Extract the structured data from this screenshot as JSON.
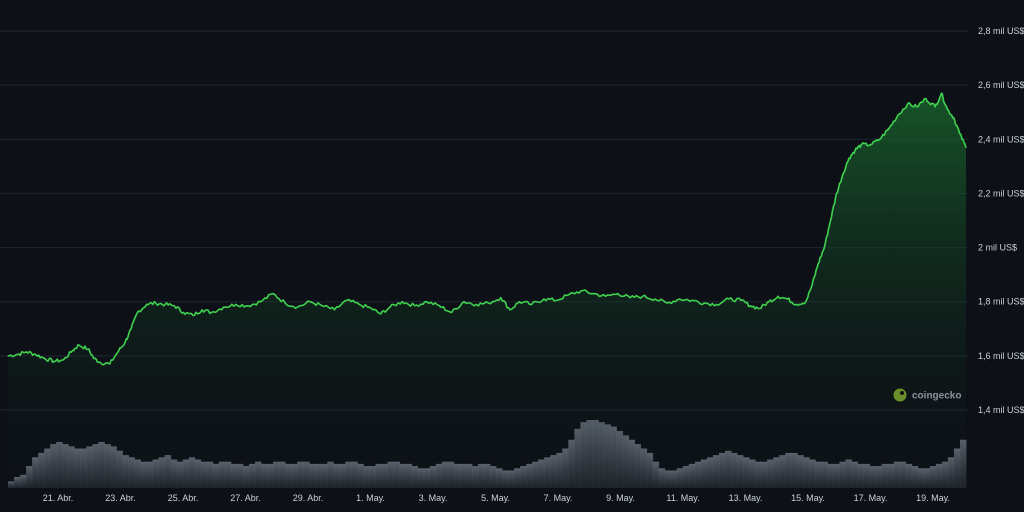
{
  "chart_data": {
    "type": "area",
    "title": "",
    "xlabel": "",
    "ylabel": "",
    "x_ticks": [
      "21. Abr.",
      "23. Abr.",
      "25. Abr.",
      "27. Abr.",
      "29. Abr.",
      "1. May.",
      "3. May.",
      "5. May.",
      "7. May.",
      "9. May.",
      "11. May.",
      "13. May.",
      "15. May.",
      "17. May.",
      "19. May."
    ],
    "y_ticks": [
      {
        "value": 1400,
        "label": "1,4 mil US$"
      },
      {
        "value": 1600,
        "label": "1,6 mil US$"
      },
      {
        "value": 1800,
        "label": "1,8 mil US$"
      },
      {
        "value": 2000,
        "label": "2 mil US$"
      },
      {
        "value": 2200,
        "label": "2,2 mil US$"
      },
      {
        "value": 2400,
        "label": "2,4 mil US$"
      },
      {
        "value": 2600,
        "label": "2,6 mil US$"
      },
      {
        "value": 2800,
        "label": "2,8 mil US$"
      }
    ],
    "ylim": [
      1400,
      2800
    ],
    "xlim": [
      0,
      31.1
    ],
    "x_unit": "days since 20. Abr.",
    "series": [
      {
        "values": [
          [
            0.0,
            1600
          ],
          [
            0.3,
            1605
          ],
          [
            0.6,
            1615
          ],
          [
            0.9,
            1605
          ],
          [
            1.2,
            1590
          ],
          [
            1.5,
            1580
          ],
          [
            1.8,
            1585
          ],
          [
            2.1,
            1620
          ],
          [
            2.3,
            1640
          ],
          [
            2.6,
            1625
          ],
          [
            2.8,
            1590
          ],
          [
            3.0,
            1575
          ],
          [
            3.3,
            1570
          ],
          [
            3.6,
            1620
          ],
          [
            3.8,
            1650
          ],
          [
            4.0,
            1700
          ],
          [
            4.2,
            1760
          ],
          [
            4.5,
            1790
          ],
          [
            4.8,
            1795
          ],
          [
            5.1,
            1790
          ],
          [
            5.4,
            1785
          ],
          [
            5.7,
            1760
          ],
          [
            6.0,
            1750
          ],
          [
            6.3,
            1770
          ],
          [
            6.6,
            1760
          ],
          [
            7.0,
            1780
          ],
          [
            7.4,
            1790
          ],
          [
            7.8,
            1785
          ],
          [
            8.2,
            1800
          ],
          [
            8.6,
            1830
          ],
          [
            9.0,
            1795
          ],
          [
            9.4,
            1780
          ],
          [
            9.8,
            1800
          ],
          [
            10.2,
            1785
          ],
          [
            10.6,
            1770
          ],
          [
            11.0,
            1805
          ],
          [
            11.4,
            1790
          ],
          [
            11.8,
            1775
          ],
          [
            12.1,
            1755
          ],
          [
            12.4,
            1780
          ],
          [
            12.8,
            1800
          ],
          [
            13.2,
            1785
          ],
          [
            13.6,
            1800
          ],
          [
            14.0,
            1785
          ],
          [
            14.4,
            1760
          ],
          [
            14.8,
            1800
          ],
          [
            15.2,
            1790
          ],
          [
            15.6,
            1795
          ],
          [
            16.0,
            1815
          ],
          [
            16.3,
            1770
          ],
          [
            16.6,
            1800
          ],
          [
            17.0,
            1790
          ],
          [
            17.4,
            1810
          ],
          [
            17.8,
            1805
          ],
          [
            18.2,
            1825
          ],
          [
            18.6,
            1840
          ],
          [
            19.0,
            1830
          ],
          [
            19.4,
            1820
          ],
          [
            19.8,
            1830
          ],
          [
            20.2,
            1815
          ],
          [
            20.6,
            1820
          ],
          [
            21.0,
            1810
          ],
          [
            21.4,
            1795
          ],
          [
            21.8,
            1810
          ],
          [
            22.2,
            1805
          ],
          [
            22.6,
            1795
          ],
          [
            23.0,
            1790
          ],
          [
            23.4,
            1810
          ],
          [
            23.8,
            1805
          ],
          [
            24.1,
            1785
          ],
          [
            24.4,
            1775
          ],
          [
            24.7,
            1800
          ],
          [
            25.0,
            1820
          ],
          [
            25.3,
            1810
          ],
          [
            25.6,
            1790
          ],
          [
            25.9,
            1800
          ],
          [
            26.1,
            1860
          ],
          [
            26.3,
            1940
          ],
          [
            26.5,
            2000
          ],
          [
            26.7,
            2100
          ],
          [
            26.9,
            2200
          ],
          [
            27.1,
            2270
          ],
          [
            27.3,
            2330
          ],
          [
            27.5,
            2360
          ],
          [
            27.7,
            2380
          ],
          [
            28.0,
            2380
          ],
          [
            28.3,
            2400
          ],
          [
            28.6,
            2440
          ],
          [
            28.9,
            2490
          ],
          [
            29.2,
            2530
          ],
          [
            29.5,
            2520
          ],
          [
            29.8,
            2550
          ],
          [
            30.1,
            2520
          ],
          [
            30.3,
            2570
          ],
          [
            30.5,
            2510
          ],
          [
            30.7,
            2480
          ],
          [
            30.9,
            2420
          ],
          [
            31.1,
            2370
          ]
        ]
      }
    ],
    "volume": [
      3,
      5,
      6,
      10,
      14,
      16,
      18,
      20,
      21,
      20,
      19,
      18,
      18,
      19,
      20,
      21,
      20,
      19,
      17,
      15,
      14,
      13,
      12,
      12,
      13,
      14,
      15,
      13,
      12,
      13,
      14,
      13,
      12,
      12,
      11,
      12,
      12,
      11,
      11,
      10,
      11,
      12,
      11,
      11,
      12,
      12,
      11,
      11,
      12,
      12,
      11,
      11,
      11,
      12,
      11,
      11,
      12,
      12,
      11,
      10,
      10,
      11,
      11,
      12,
      12,
      11,
      11,
      10,
      9,
      9,
      10,
      11,
      12,
      12,
      11,
      11,
      11,
      10,
      11,
      11,
      10,
      9,
      8,
      8,
      9,
      10,
      11,
      12,
      13,
      14,
      15,
      16,
      18,
      22,
      27,
      30,
      31,
      31,
      30,
      29,
      28,
      26,
      24,
      22,
      20,
      18,
      16,
      12,
      9,
      8,
      8,
      9,
      10,
      11,
      12,
      13,
      14,
      15,
      16,
      17,
      16,
      15,
      14,
      13,
      12,
      12,
      13,
      14,
      15,
      16,
      16,
      15,
      14,
      13,
      12,
      12,
      11,
      11,
      12,
      13,
      12,
      11,
      11,
      10,
      10,
      11,
      11,
      12,
      12,
      11,
      10,
      9,
      9,
      10,
      11,
      12,
      14,
      18,
      22
    ],
    "grid": true,
    "legend": "none"
  },
  "branding": {
    "name": "coingecko"
  },
  "colors": {
    "background": "#0d1117",
    "line": "#3fd14f",
    "grid": "#1f2630",
    "volume": "#5a626d"
  }
}
